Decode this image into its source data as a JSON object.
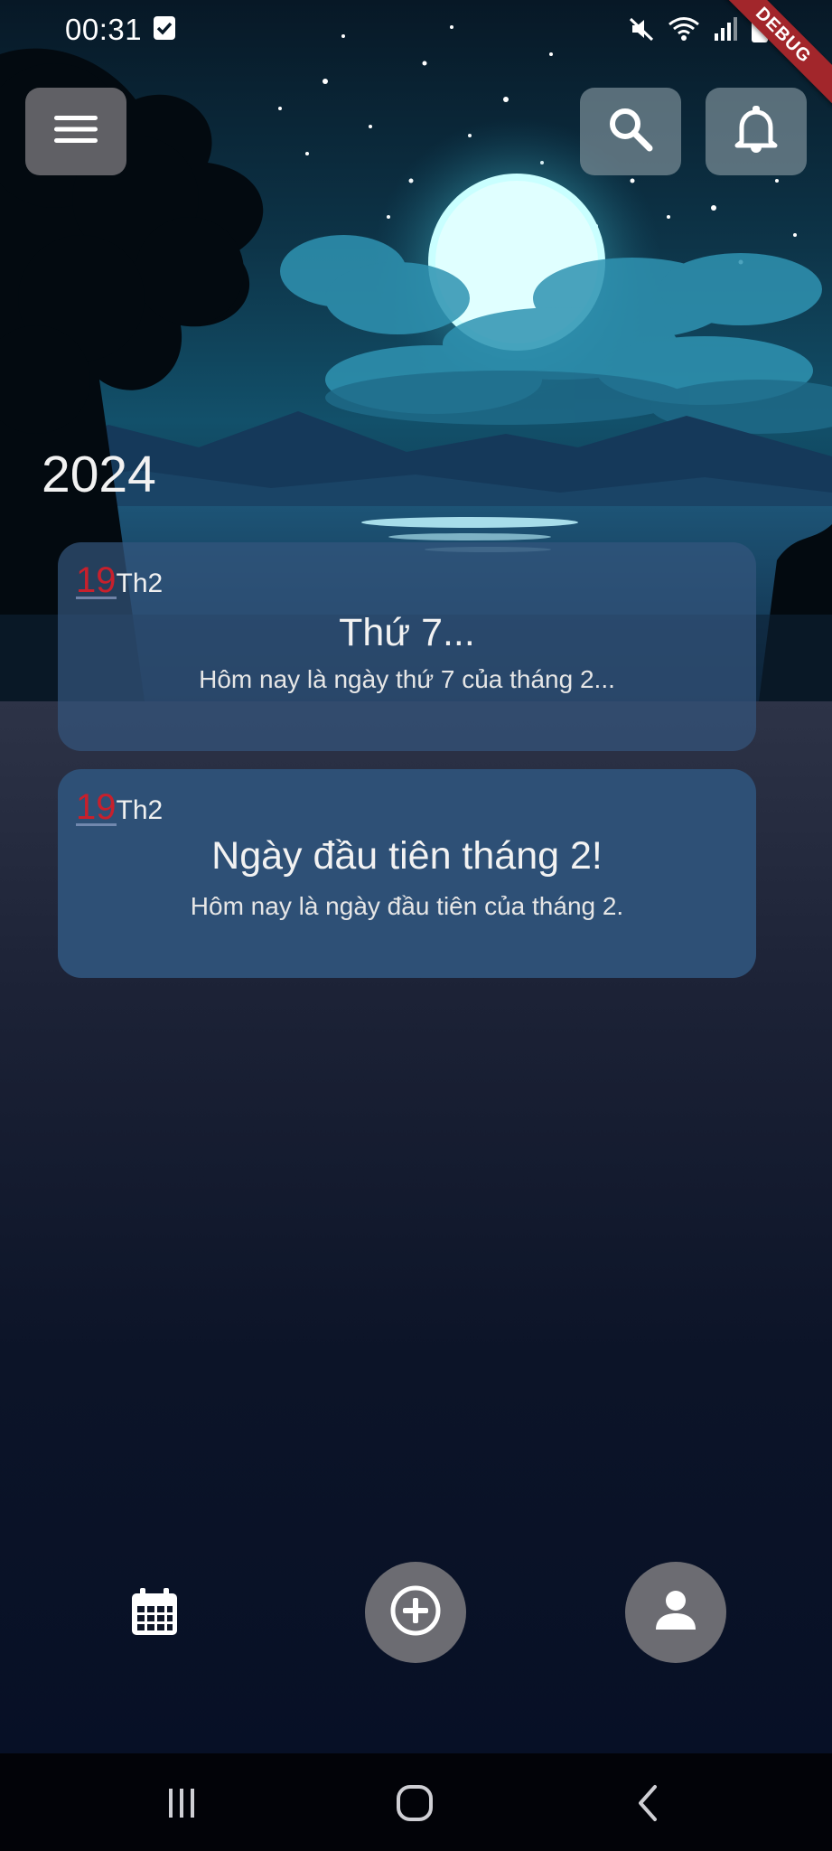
{
  "status_bar": {
    "time": "00:31",
    "icons": [
      "checkbox-notification-icon",
      "mute-icon",
      "wifi-icon",
      "signal-icon",
      "battery-icon"
    ]
  },
  "debug_banner": "DEBUG",
  "header": {
    "menu_icon": "hamburger-menu-icon",
    "search_icon": "search-icon",
    "notification_icon": "bell-icon"
  },
  "year": "2024",
  "notes": [
    {
      "day": "19",
      "month": "Th2",
      "title": "Thứ 7...",
      "body": "Hôm nay là ngày thứ 7 của tháng 2..."
    },
    {
      "day": "19",
      "month": "Th2",
      "title": "Ngày đầu tiên tháng 2!",
      "body": "Hôm nay là ngày đầu tiên của tháng 2."
    }
  ],
  "bottom_nav": {
    "items": [
      "calendar-icon",
      "add-circle-icon",
      "person-icon"
    ]
  },
  "system_nav": [
    "recents-button",
    "home-button",
    "back-button"
  ],
  "colors": {
    "card": "#35557d",
    "date_day": "#c8202c",
    "button_bg": "#6c6c72",
    "debug": "#a2262b"
  }
}
